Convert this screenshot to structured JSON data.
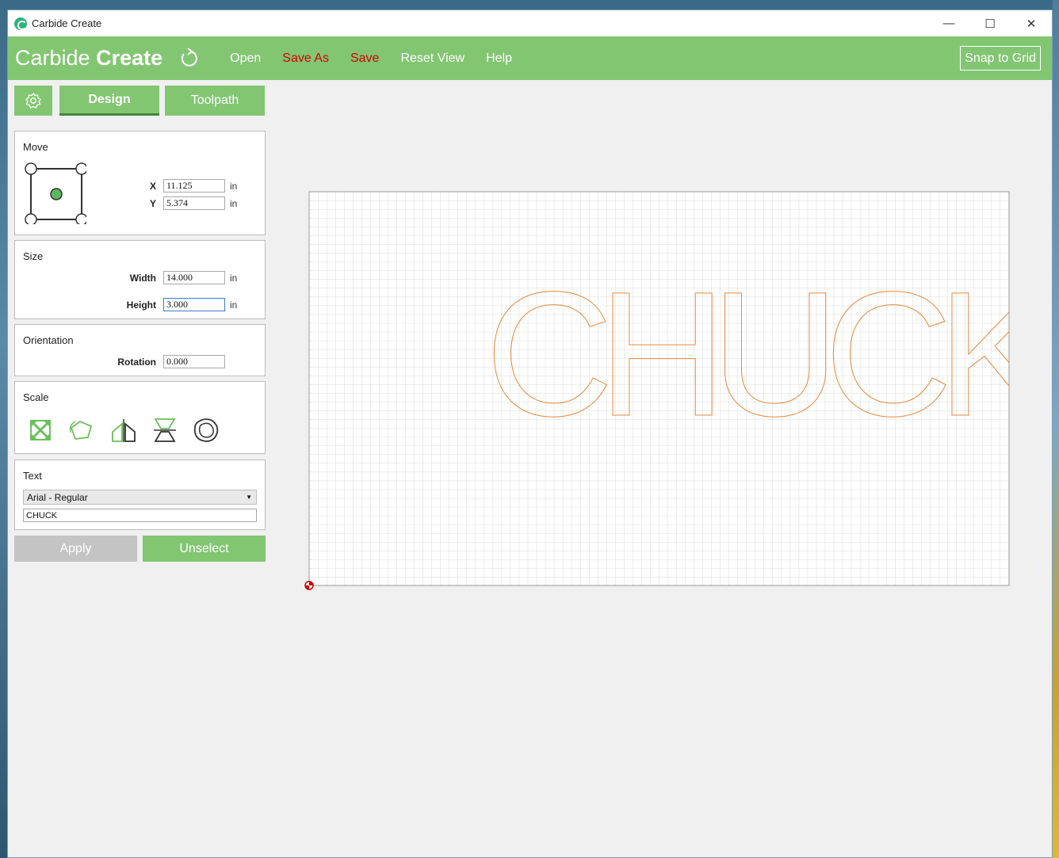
{
  "window": {
    "title": "Carbide Create"
  },
  "window_controls": {
    "minimize": "—",
    "maximize": "☐",
    "close": "✕"
  },
  "toolbar": {
    "brand_light": "Carbide",
    "brand_bold": "Create",
    "open": "Open",
    "save_as": "Save As",
    "save": "Save",
    "reset_view": "Reset View",
    "help": "Help",
    "snap_to_grid": "Snap to Grid"
  },
  "tabs": {
    "design": "Design",
    "toolpath": "Toolpath"
  },
  "move": {
    "title": "Move",
    "x_label": "X",
    "x_value": "11.125",
    "y_label": "Y",
    "y_value": "5.374",
    "unit": "in"
  },
  "size": {
    "title": "Size",
    "width_label": "Width",
    "width_value": "14.000",
    "height_label": "Height",
    "height_value": "3.000",
    "unit": "in"
  },
  "orientation": {
    "title": "Orientation",
    "rotation_label": "Rotation",
    "rotation_value": "0.000"
  },
  "scale": {
    "title": "Scale",
    "icons": [
      "fit-scale-icon",
      "rotate-shape-icon",
      "mirror-horizontal-icon",
      "mirror-vertical-icon",
      "offset-shape-icon"
    ]
  },
  "text": {
    "title": "Text",
    "font": "Arial - Regular",
    "value": "CHUCK"
  },
  "actions": {
    "apply": "Apply",
    "unselect": "Unselect"
  },
  "canvas": {
    "text": "CHUCK",
    "text_color": "#e8873a",
    "grid_color": "#c8c8c8"
  },
  "colors": {
    "accent": "#82c672",
    "danger": "#d40000"
  }
}
